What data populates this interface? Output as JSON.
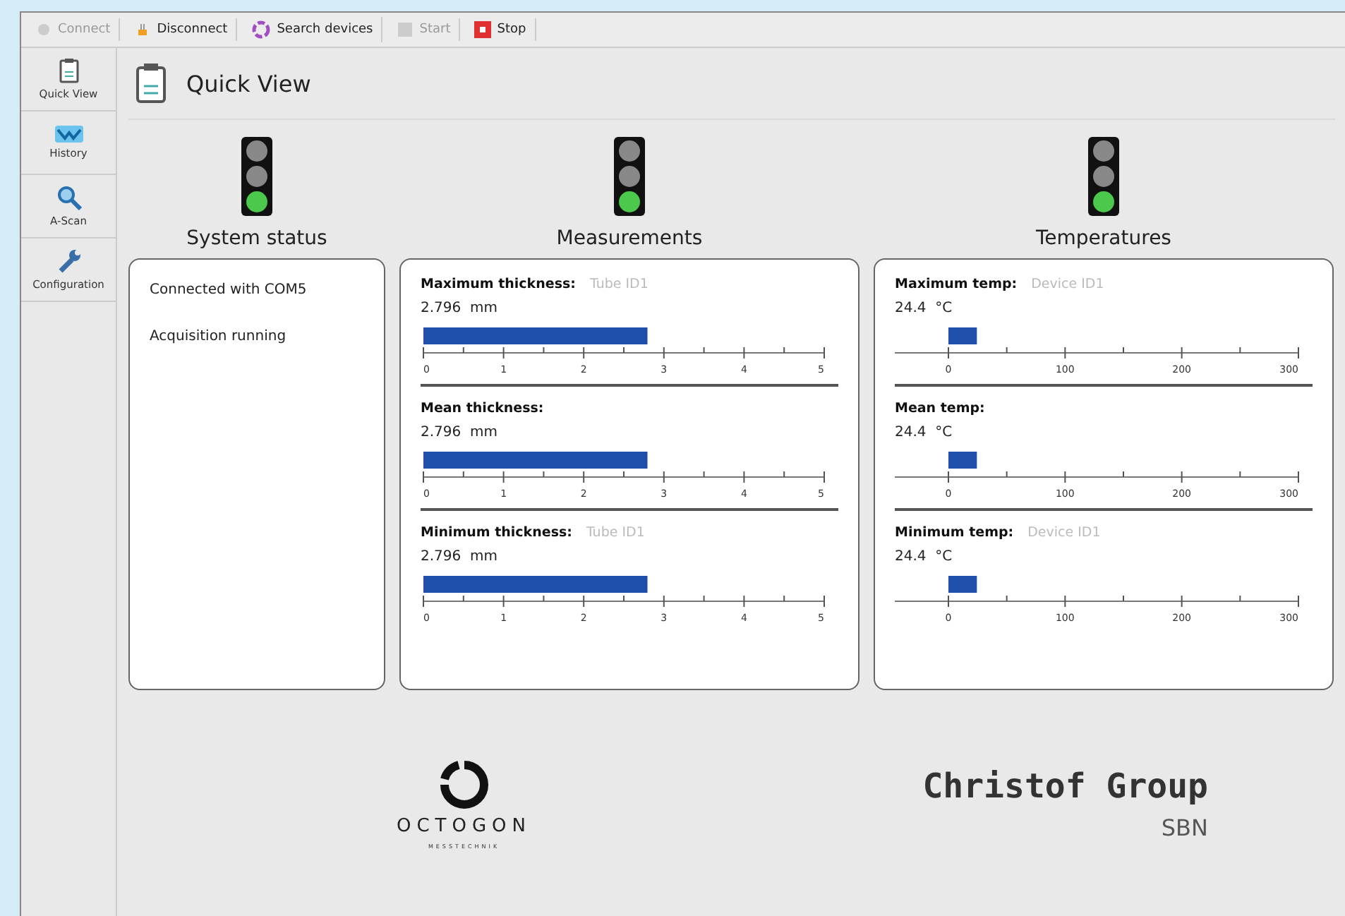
{
  "toolbar": [
    {
      "label": "Connect",
      "kind": "connect",
      "disabled": true
    },
    {
      "label": "Disconnect",
      "kind": "disconnect",
      "disabled": false
    },
    {
      "label": "Search devices",
      "kind": "search",
      "disabled": false
    },
    {
      "label": "Start",
      "kind": "start",
      "disabled": true
    },
    {
      "label": "Stop",
      "kind": "stop",
      "disabled": false
    }
  ],
  "sidebar": {
    "items": [
      {
        "label": "Quick View",
        "kind": "clipboard"
      },
      {
        "label": "History",
        "kind": "wave"
      },
      {
        "label": "A-Scan",
        "kind": "magnifier"
      },
      {
        "label": "Configuration",
        "kind": "wrench"
      }
    ]
  },
  "page_title": "Quick View",
  "panels": [
    {
      "title": "System status",
      "lamps": [
        {
          "on": false
        },
        {
          "on": false
        },
        {
          "on": true
        }
      ],
      "kind": "status",
      "lines": [
        "Connected with COM5",
        "Acquisition running"
      ]
    },
    {
      "title": "Measurements",
      "lamps": [
        {
          "on": false
        },
        {
          "on": false
        },
        {
          "on": true
        }
      ],
      "kind": "meters",
      "meters": [
        {
          "label": "Maximum thickness:",
          "source": "Tube ID1",
          "value": "2.796",
          "unit": "mm",
          "kind": "thickness",
          "level": 0.559,
          "ticks": [
            "0",
            "1",
            "2",
            "3",
            "4",
            "5"
          ]
        },
        {
          "label": "Mean thickness:",
          "value": "2.796",
          "unit": "mm",
          "kind": "thickness",
          "level": 0.559,
          "ticks": [
            "0",
            "1",
            "2",
            "3",
            "4",
            "5"
          ]
        },
        {
          "label": "Minimum thickness:",
          "source": "Tube ID1",
          "value": "2.796",
          "unit": "mm",
          "kind": "thickness",
          "level": 0.559,
          "ticks": [
            "0",
            "1",
            "2",
            "3",
            "4",
            "5"
          ]
        }
      ]
    },
    {
      "title": "Temperatures",
      "lamps": [
        {
          "on": false
        },
        {
          "on": false
        },
        {
          "on": true
        }
      ],
      "kind": "meters",
      "meters": [
        {
          "label": "Maximum temp:",
          "source": "Device ID1",
          "value": "24.4",
          "unit": "°C",
          "kind": "temperature",
          "ticks": [
            "0",
            "100",
            "200",
            "300"
          ]
        },
        {
          "label": "Mean temp:",
          "value": "24.4",
          "unit": "°C",
          "kind": "temperature",
          "ticks": [
            "0",
            "100",
            "200",
            "300"
          ]
        },
        {
          "label": "Minimum temp:",
          "source": "Device ID1",
          "value": "24.4",
          "unit": "°C",
          "kind": "temperature",
          "ticks": [
            "0",
            "100",
            "200",
            "300"
          ]
        }
      ]
    }
  ],
  "footer": {
    "logo_name": "OCTOGON",
    "logo_sub": "MESSTECHNIK",
    "brand": "Christof Group",
    "brand_sub": "SBN"
  }
}
